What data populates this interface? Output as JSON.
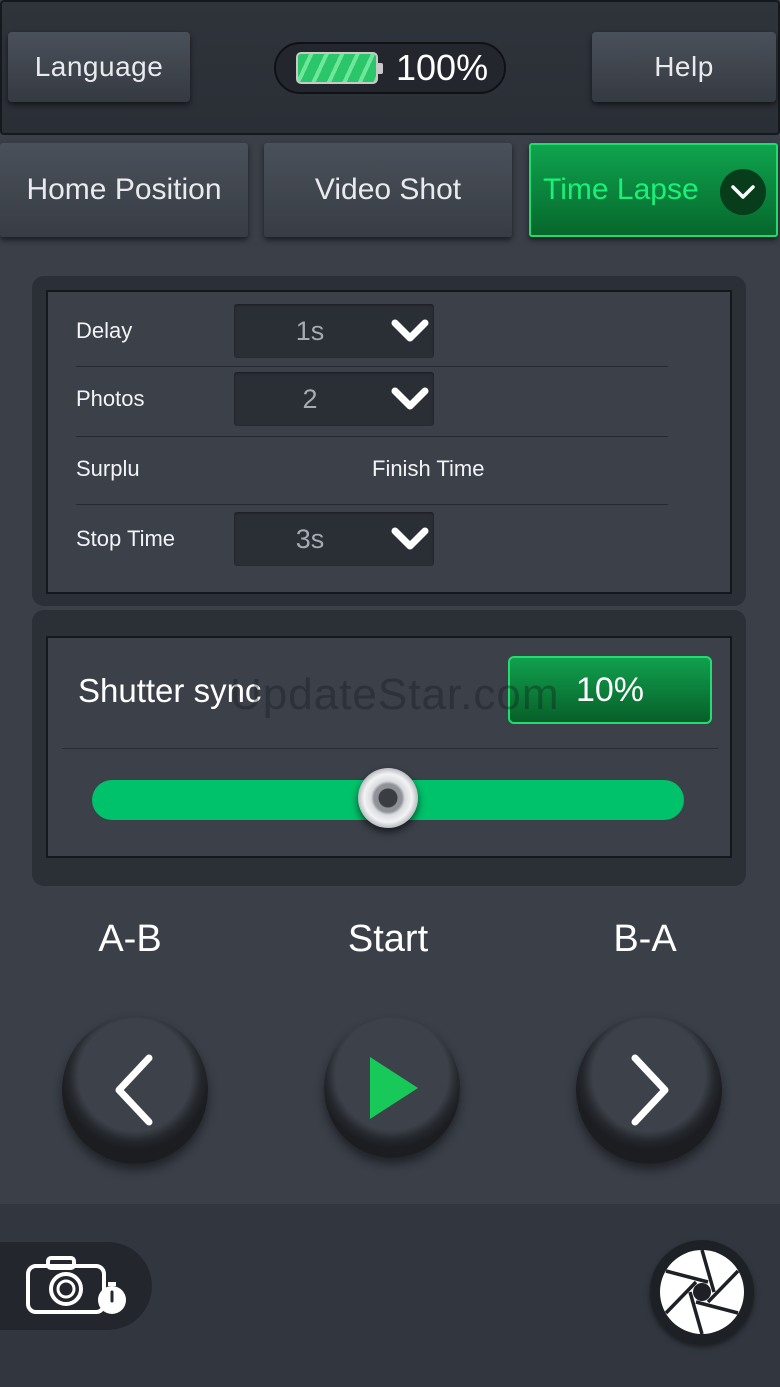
{
  "header": {
    "language_label": "Language",
    "help_label": "Help",
    "battery_percent": "100%",
    "battery_level": 1.0
  },
  "tabs": [
    {
      "label": "Home Position",
      "active": false
    },
    {
      "label": "Video Shot",
      "active": false
    },
    {
      "label": "Time Lapse",
      "active": true
    }
  ],
  "settings": {
    "delay": {
      "label": "Delay",
      "value": "1s"
    },
    "photos": {
      "label": "Photos",
      "value": "2"
    },
    "surplus": {
      "label": "Surplu"
    },
    "finish_time": {
      "label": "Finish Time"
    },
    "stop_time": {
      "label": "Stop Time",
      "value": "3s"
    }
  },
  "shutter_sync": {
    "label": "Shutter sync",
    "value": "10%",
    "slider_position": 0.5
  },
  "watermark": "UpdateStar.com",
  "controls": {
    "ab_label": "A-B",
    "start_label": "Start",
    "ba_label": "B-A"
  },
  "colors": {
    "accent_green": "#00c26a",
    "active_tab_text": "#1bf07a",
    "background": "#3a3f48"
  },
  "icons": {
    "battery": "battery-icon",
    "dropdown": "chevron-down-icon",
    "left": "chevron-left-icon",
    "play": "play-icon",
    "right": "chevron-right-icon",
    "camera_timer": "camera-timer-icon",
    "aperture": "aperture-icon"
  }
}
